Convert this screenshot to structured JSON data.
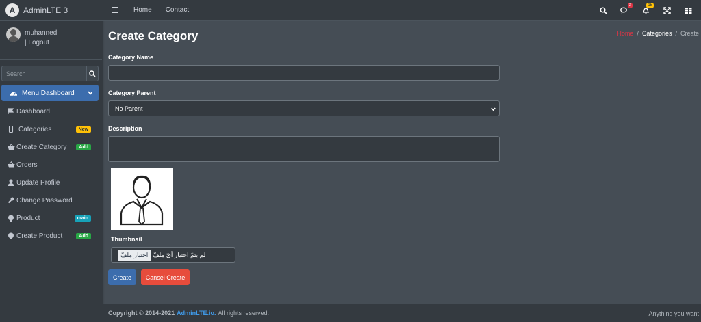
{
  "brand": {
    "logo_letter": "A",
    "name": "AdminLTE 3"
  },
  "user": {
    "name": "muhanned",
    "logout": "| Logout"
  },
  "search": {
    "placeholder": "Search"
  },
  "sidebar": {
    "menu_dashboard": "Menu Dashboard",
    "items": [
      {
        "label": "Dashboard",
        "icon": "dashboard-icon"
      },
      {
        "label": "Categories",
        "icon": "mobile-icon",
        "badge": "New",
        "badge_color": "#ffc107"
      },
      {
        "label": "Create Category",
        "icon": "basket-icon",
        "badge": "Add",
        "badge_color": "#28a745"
      },
      {
        "label": "Orders",
        "icon": "basket-icon"
      },
      {
        "label": "Update Profile",
        "icon": "user-icon"
      },
      {
        "label": "Change Password",
        "icon": "wrench-icon"
      },
      {
        "label": "Product",
        "icon": "brain-icon",
        "badge": "main",
        "badge_color": "#17a2b8"
      },
      {
        "label": "Create Product",
        "icon": "brain-icon",
        "badge": "Add",
        "badge_color": "#28a745"
      }
    ]
  },
  "topbar": {
    "links": [
      "Home",
      "Contact"
    ],
    "messages_count": "3",
    "notifications_count": "15"
  },
  "page": {
    "title": "Create Category",
    "breadcrumb": [
      "Home",
      "Categories",
      "Create"
    ]
  },
  "form": {
    "name_label": "Category Name",
    "name_value": "",
    "parent_label": "Category Parent",
    "parent_selected": "No Parent",
    "description_label": "Description",
    "description_value": "",
    "thumbnail_label": "Thumbnail",
    "file_button": "اختيار ملفّ",
    "file_status": "لم يتمّ اختيار أيّ ملفّ",
    "create_button": "Create",
    "cancel_button": "Cansel Create"
  },
  "footer": {
    "copyright": "Copyright © 2014-2021",
    "link": "AdminLTE.io.",
    "rights": "All rights reserved.",
    "right_text": "Anything you want"
  },
  "colors": {
    "accent": "#3c6dad",
    "danger": "#e74c3c",
    "bg": "#454d55",
    "sidebar": "#343a40"
  }
}
